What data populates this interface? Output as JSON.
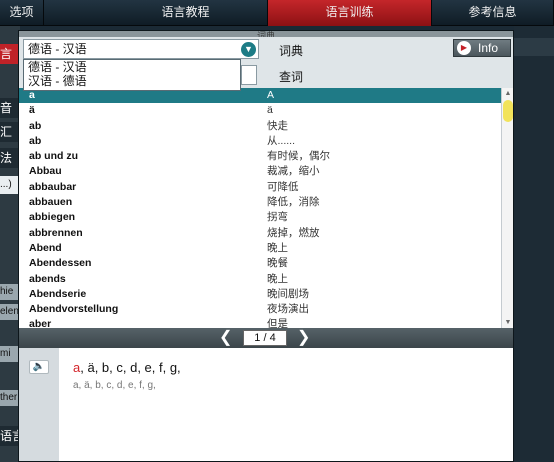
{
  "topbar": {
    "tabs": [
      "选项",
      "语言教程",
      "语言训练",
      "参考信息"
    ],
    "active_index": 2
  },
  "background_left": {
    "items": [
      "言",
      "音",
      "汇",
      "法",
      "...)",
      "hie",
      "elen",
      "mi",
      "ther",
      "语言"
    ]
  },
  "dialog": {
    "title": "词典",
    "dropdown_value": "德语 - 汉语",
    "dropdown_options": [
      "德语 - 汉语",
      "汉语 - 德语"
    ],
    "dictionary_label": "词典",
    "query_label": "查词",
    "info_button": "Info"
  },
  "wordlist": {
    "selected_index": 0,
    "rows": [
      {
        "de": "a",
        "zh": "A"
      },
      {
        "de": "ä",
        "zh": "ä"
      },
      {
        "de": "ab",
        "zh": "快走"
      },
      {
        "de": "ab",
        "zh": "从......"
      },
      {
        "de": "ab und zu",
        "zh": "有时候，偶尔"
      },
      {
        "de": "Abbau",
        "zh": "裁减，缩小"
      },
      {
        "de": "abbaubar",
        "zh": "可降低"
      },
      {
        "de": "abbauen",
        "zh": "降低，消除"
      },
      {
        "de": "abbiegen",
        "zh": "拐弯"
      },
      {
        "de": "abbrennen",
        "zh": "烧掉，燃放"
      },
      {
        "de": "Abend",
        "zh": "晚上"
      },
      {
        "de": "Abendessen",
        "zh": "晚餐"
      },
      {
        "de": "abends",
        "zh": "晚上"
      },
      {
        "de": "Abendserie",
        "zh": "晚间剧场"
      },
      {
        "de": "Abendvorstellung",
        "zh": "夜场演出"
      },
      {
        "de": "aber",
        "zh": "但是"
      }
    ]
  },
  "pager": {
    "page_text": "1 / 4",
    "prev": "❮",
    "next": "❯"
  },
  "detail": {
    "speaker_glyph": "🔈",
    "highlight": "a",
    "main_rest": ", ä, b, c, d, e, f, g,",
    "sub": "a, ä, b, c, d, e, f, g,"
  },
  "colors": {
    "accent": "#1f7a86",
    "active_tab": "#c4262a",
    "scroll_thumb": "#f2e35a"
  }
}
